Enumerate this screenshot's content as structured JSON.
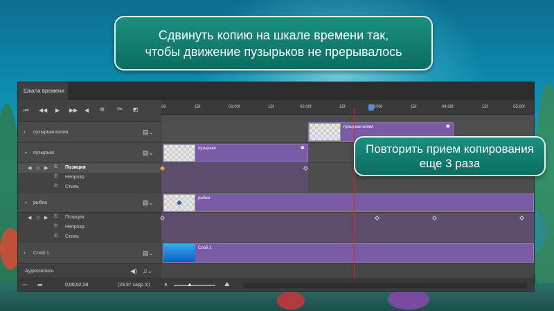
{
  "instructions": {
    "top_line1": "Сдвинуть копию на шкале времени так,",
    "top_line2": "чтобы движение пузырьков не прерывалось",
    "mid_line1": "Повторить прием копирования",
    "mid_line2": "еще 3 раза"
  },
  "panel": {
    "tab_label": "Шкала времени"
  },
  "ruler": {
    "ticks": [
      "00",
      "15f",
      "01:00f",
      "15f",
      "02:00f",
      "15f",
      "03:00f",
      "15f",
      "04:00f",
      "15f",
      "05:00f"
    ]
  },
  "layers": [
    {
      "name": "пузырьки копия",
      "clip_label": "пузырьки копия"
    },
    {
      "name": "пузырьки",
      "clip_label": "пузырьки",
      "props": [
        "Позиция",
        "Непрозр.",
        "Стиль"
      ]
    },
    {
      "name": "рыбка",
      "clip_label": "рыбка",
      "props": [
        "Позиция",
        "Непрозр.",
        "Стиль"
      ]
    },
    {
      "name": "Слой 1",
      "clip_label": "Слой 1"
    }
  ],
  "audio_label": "Аудиозапись",
  "status": {
    "timecode": "0;00;02;28",
    "fps": "(29.97 кадр./с)"
  },
  "icons": {
    "first_frame": "skip-back-icon",
    "prev_frame": "step-back-icon",
    "play": "play-icon",
    "next_frame": "step-forward-icon",
    "mute": "speaker-icon",
    "settings": "gear-icon",
    "split": "scissors-icon",
    "transition": "transition-icon"
  },
  "colors": {
    "clip": "#7b5aa6",
    "playhead": "#d12d2d",
    "keyframe": "#e8a33c",
    "callout": "#0b6d60"
  }
}
